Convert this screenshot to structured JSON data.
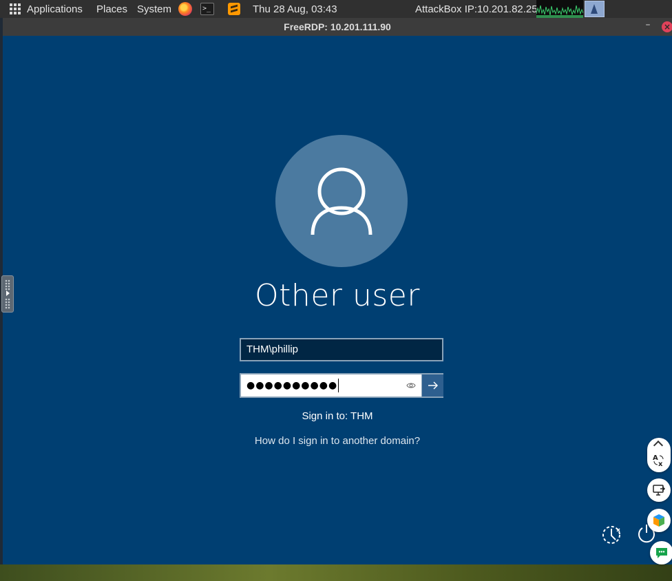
{
  "top_panel": {
    "menus": [
      "Applications",
      "Places",
      "System"
    ],
    "clock": "Thu 28 Aug, 03:43",
    "attackbox_ip": "AttackBox IP:10.201.82.25"
  },
  "window": {
    "title": "FreeRDP: 10.201.111.90",
    "minimize_label": "–",
    "close_label": "×"
  },
  "login": {
    "user_title": "Other user",
    "username_value": "THM\\phillip",
    "password_mask": "●●●●●●●●●●",
    "sign_in_to": "Sign in to: THM",
    "other_domain_link": "How do I sign in to another domain?"
  },
  "side_tools": {
    "translate_label": "A  \nx"
  },
  "colors": {
    "lock_screen_bg": "#003f72",
    "avatar_bg": "#4b7aa0",
    "panel_bg": "#303030"
  }
}
